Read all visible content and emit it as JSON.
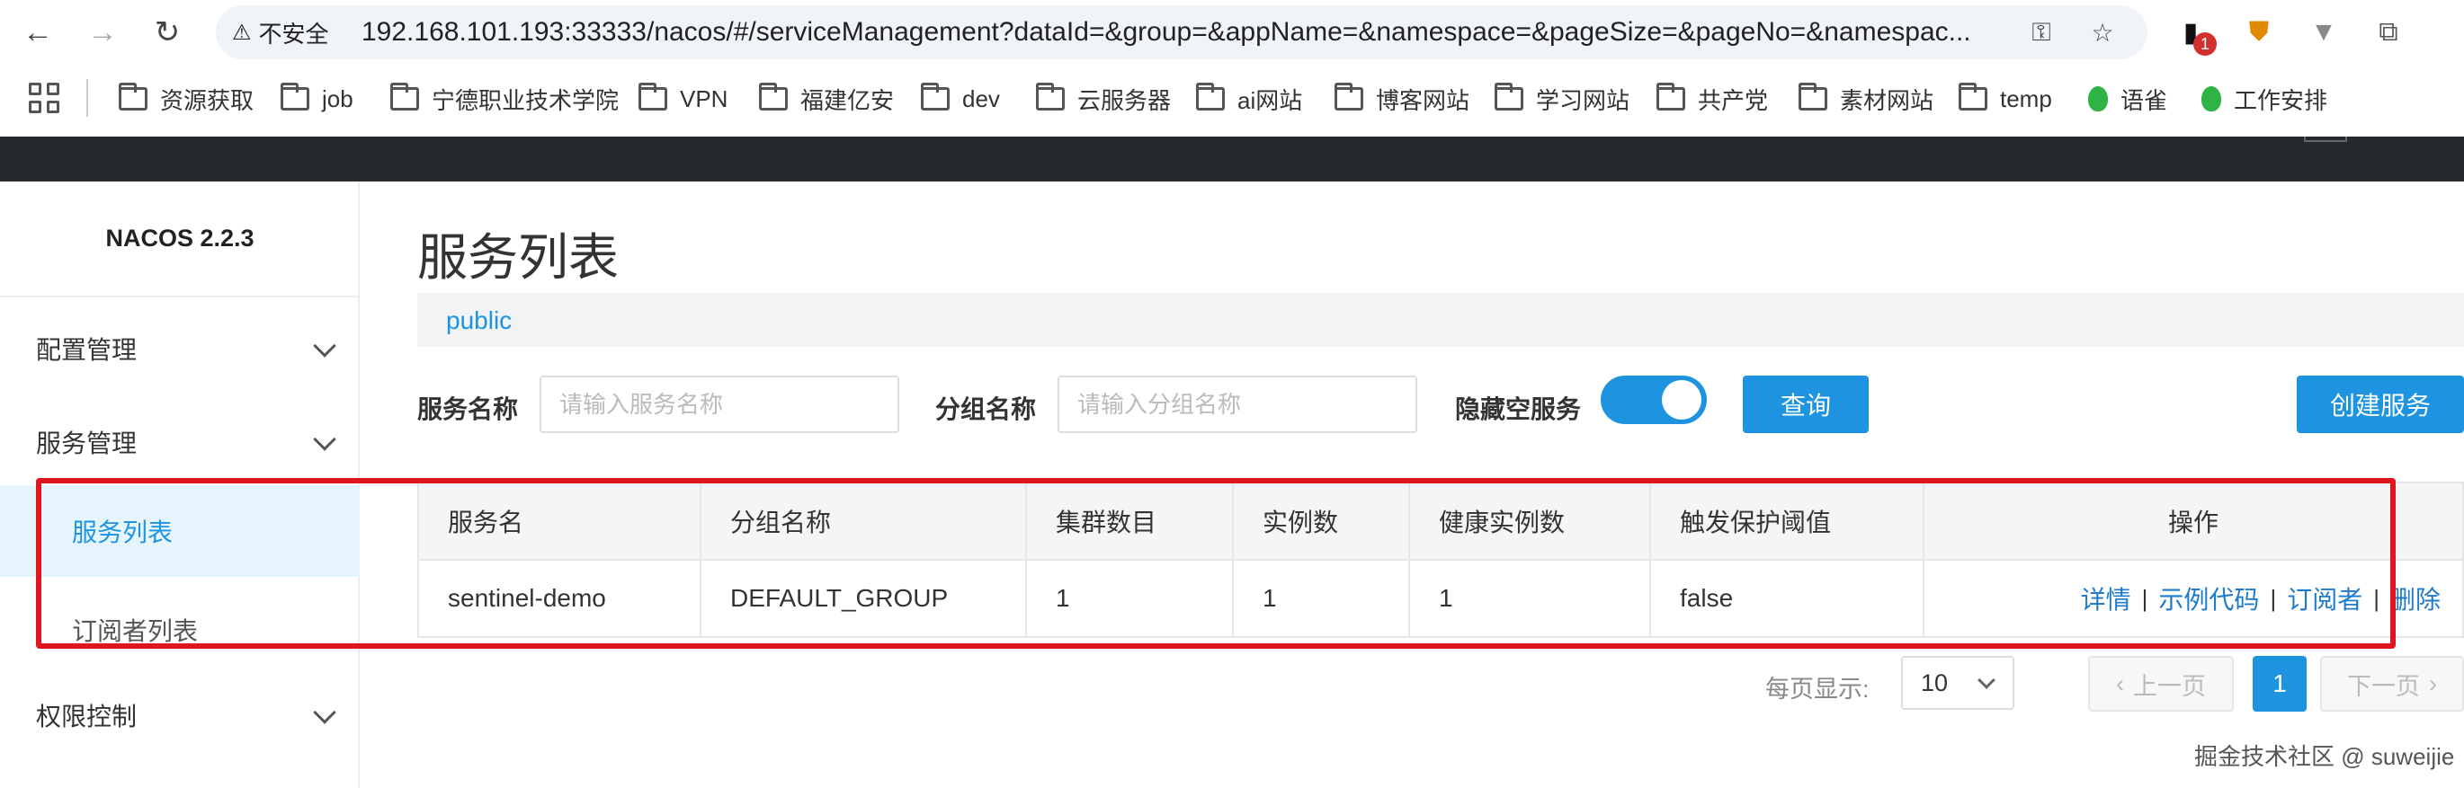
{
  "browser": {
    "insecure_label": "不安全",
    "url": "192.168.101.193:33333/nacos/#/serviceManagement?dataId=&group=&appName=&namespace=&pageSize=&pageNo=&namespac...",
    "extension_badge": "1",
    "bookmarks": [
      "资源获取",
      "job",
      "宁德职业技术学院",
      "VPN",
      "福建亿安",
      "dev",
      "云服务器",
      "ai网站",
      "博客网站",
      "学习网站",
      "共产党",
      "素材网站",
      "temp",
      "语雀",
      "工作安排"
    ]
  },
  "sidebar": {
    "brand": "NACOS 2.2.3",
    "menu": {
      "config": "配置管理",
      "service": "服务管理",
      "service_list": "服务列表",
      "subscriber_list": "订阅者列表",
      "auth": "权限控制"
    }
  },
  "main": {
    "title": "服务列表",
    "namespace": "public",
    "filters": {
      "service_name_label": "服务名称",
      "service_name_placeholder": "请输入服务名称",
      "group_name_label": "分组名称",
      "group_name_placeholder": "请输入分组名称",
      "hide_empty_label": "隐藏空服务",
      "hide_empty_on": true,
      "query_button": "查询",
      "create_button": "创建服务"
    },
    "table": {
      "headers": [
        "服务名",
        "分组名称",
        "集群数目",
        "实例数",
        "健康实例数",
        "触发保护阈值",
        "操作"
      ],
      "rows": [
        {
          "service_name": "sentinel-demo",
          "group_name": "DEFAULT_GROUP",
          "cluster_count": "1",
          "instance_count": "1",
          "healthy_instance_count": "1",
          "protect_threshold": "false",
          "ops": [
            "详情",
            "示例代码",
            "订阅者",
            "删除"
          ]
        }
      ]
    },
    "pagination": {
      "page_size_label": "每页显示:",
      "page_size": "10",
      "prev": "上一页",
      "current": "1",
      "next": "下一页"
    }
  },
  "watermark": "掘金技术社区 @ suweijie",
  "colors": {
    "primary": "#1e94e0",
    "header": "#252a2f",
    "highlight": "#e0151f"
  }
}
